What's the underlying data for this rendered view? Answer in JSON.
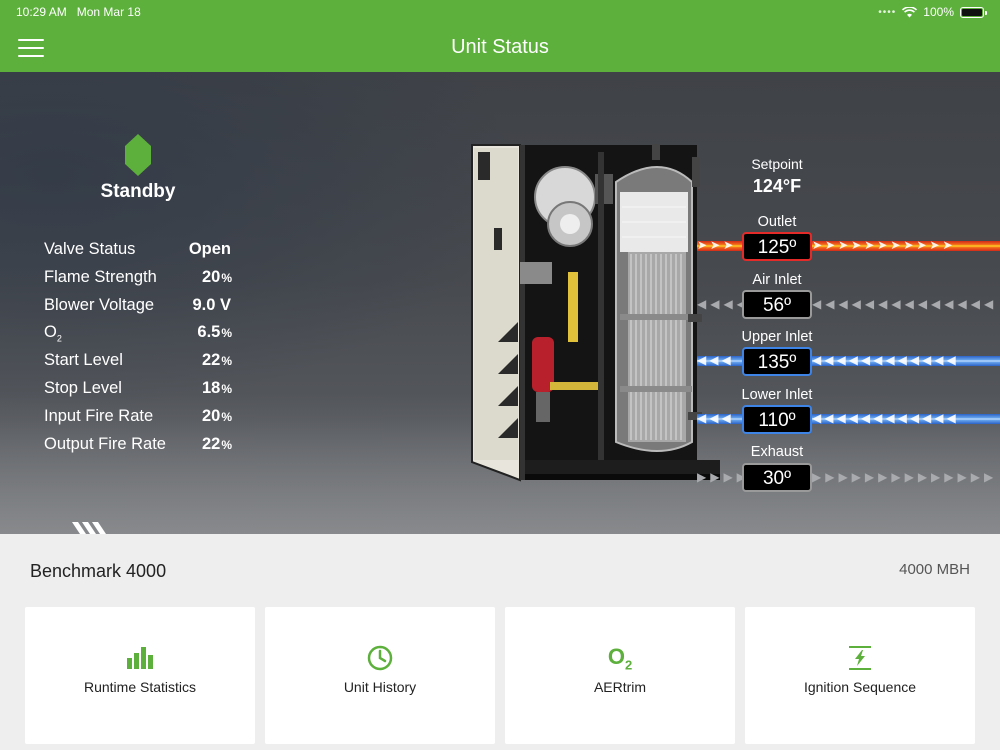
{
  "status_bar": {
    "time": "10:29 AM",
    "date": "Mon Mar 18",
    "battery": "100%"
  },
  "header": {
    "title": "Unit Status",
    "menu_icon": "hamburger-menu-icon"
  },
  "unit": {
    "state": "Standby",
    "state_color": "#5cb03b",
    "stats": [
      {
        "label": "Valve Status",
        "value": "Open",
        "unit": ""
      },
      {
        "label": "Flame Strength",
        "value": "20",
        "unit": "%"
      },
      {
        "label": "Blower Voltage",
        "value": "9.0 V",
        "unit": ""
      },
      {
        "label": "O",
        "label_sub": "2",
        "value": "6.5",
        "unit": "%"
      },
      {
        "label": "Start Level",
        "value": "22",
        "unit": "%"
      },
      {
        "label": "Stop Level",
        "value": "18",
        "unit": "%"
      },
      {
        "label": "Input Fire Rate",
        "value": "20",
        "unit": "%"
      },
      {
        "label": "Output Fire Rate",
        "value": "22",
        "unit": "%"
      }
    ]
  },
  "temps": {
    "setpoint_label": "Setpoint",
    "setpoint_value": "124°F",
    "sensors": [
      {
        "label": "Outlet",
        "value": "125º",
        "kind": "hot"
      },
      {
        "label": "Air Inlet",
        "value": "56º",
        "kind": "neutral"
      },
      {
        "label": "Upper Inlet",
        "value": "135º",
        "kind": "cold"
      },
      {
        "label": "Lower Inlet",
        "value": "110º",
        "kind": "cold"
      },
      {
        "label": "Exhaust",
        "value": "30º",
        "kind": "neutral"
      }
    ]
  },
  "model": {
    "name": "Benchmark 4000",
    "rating": "4000 MBH"
  },
  "tiles": [
    {
      "label": "Runtime Statistics",
      "icon": "bar-chart-icon"
    },
    {
      "label": "Unit History",
      "icon": "clock-icon"
    },
    {
      "label": "AERtrim",
      "icon": "o2-icon",
      "glyph": "O",
      "glyph_sub": "2"
    },
    {
      "label": "Ignition Sequence",
      "icon": "ignition-bolt-icon"
    }
  ],
  "colors": {
    "brand_green": "#5cb03b",
    "hot": "#e52a2a",
    "cold": "#3d84e6"
  }
}
